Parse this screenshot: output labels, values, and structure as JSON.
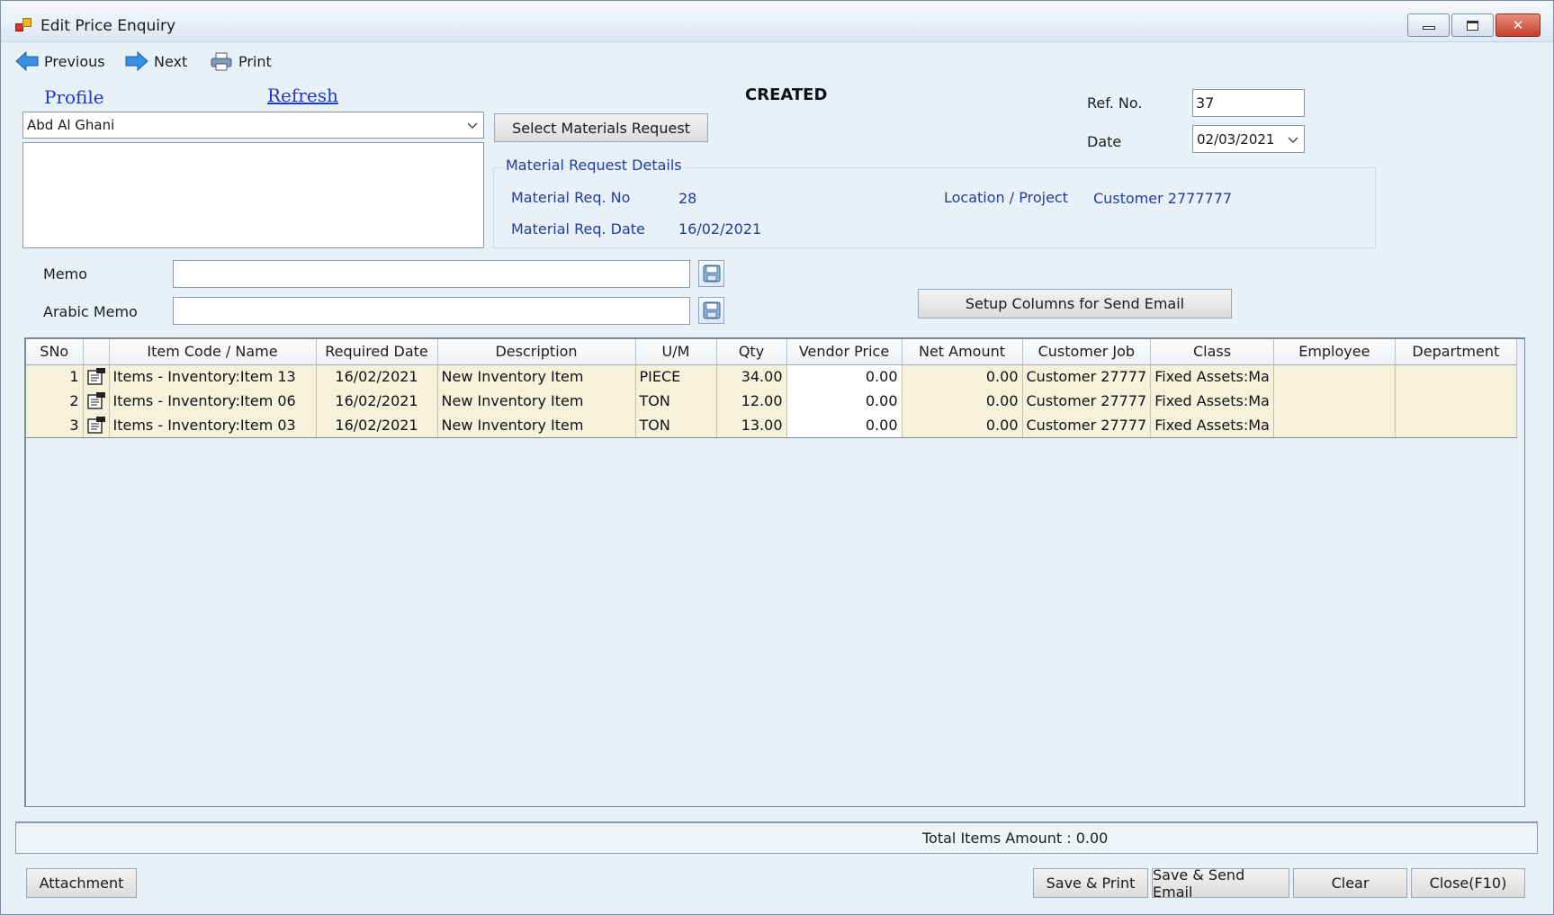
{
  "window": {
    "title": "Edit Price Enquiry"
  },
  "toolbar": {
    "previous": "Previous",
    "next": "Next",
    "print": "Print"
  },
  "links": {
    "profile": "Profile",
    "refresh": "Refresh"
  },
  "status": "CREATED",
  "vendor": {
    "selected": "Abd Al Ghani"
  },
  "buttons": {
    "select_materials_request": "Select Materials Request",
    "setup_columns": "Setup Columns for Send Email",
    "attachment": "Attachment",
    "save_print": "Save & Print",
    "save_send_email": "Save & Send Email",
    "clear": "Clear",
    "close": "Close(F10)"
  },
  "ref": {
    "label": "Ref. No.",
    "value": "37"
  },
  "date": {
    "label": "Date",
    "value": "02/03/2021"
  },
  "material_request": {
    "title": "Material Request Details",
    "req_no_label": "Material Req. No",
    "req_no": "28",
    "req_date_label": "Material Req. Date",
    "req_date": "16/02/2021",
    "location_label": "Location / Project",
    "location": "Customer 2777777"
  },
  "memo": {
    "label": "Memo",
    "value": ""
  },
  "arabic_memo": {
    "label": "Arabic Memo",
    "value": ""
  },
  "grid": {
    "columns": [
      "SNo",
      "",
      "Item Code / Name",
      "Required Date",
      "Description",
      "U/M",
      "Qty",
      "Vendor Price",
      "Net Amount",
      "Customer Job",
      "Class",
      "Employee",
      "Department"
    ],
    "rows": [
      {
        "sno": "1",
        "item": "Items - Inventory:Item 13",
        "required_date": "16/02/2021",
        "description": "New Inventory Item",
        "um": "PIECE",
        "qty": "34.00",
        "vendor_price": "0.00",
        "net_amount": "0.00",
        "customer_job": "Customer 27777",
        "class": "Fixed Assets:Ma",
        "employee": "",
        "department": ""
      },
      {
        "sno": "2",
        "item": "Items - Inventory:Item 06",
        "required_date": "16/02/2021",
        "description": "New Inventory Item",
        "um": "TON",
        "qty": "12.00",
        "vendor_price": "0.00",
        "net_amount": "0.00",
        "customer_job": "Customer 27777",
        "class": "Fixed Assets:Ma",
        "employee": "",
        "department": ""
      },
      {
        "sno": "3",
        "item": "Items - Inventory:Item 03",
        "required_date": "16/02/2021",
        "description": "New Inventory Item",
        "um": "TON",
        "qty": "13.00",
        "vendor_price": "0.00",
        "net_amount": "0.00",
        "customer_job": "Customer 27777",
        "class": "Fixed Assets:Ma",
        "employee": "",
        "department": ""
      }
    ]
  },
  "total": {
    "text": "Total Items Amount : 0.00"
  },
  "icons": {
    "row_action": "edit-document-icon",
    "memo_action": "save-disk-icon"
  }
}
